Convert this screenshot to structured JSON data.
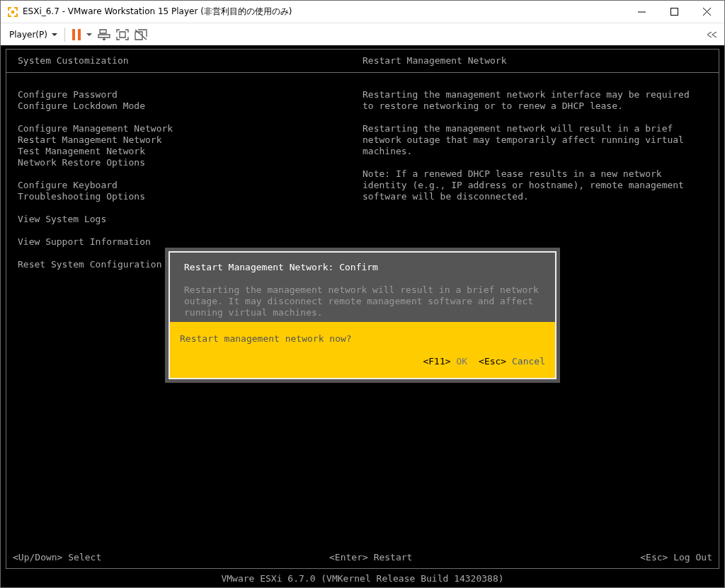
{
  "window": {
    "title": "ESXi_6.7 - VMware Workstation 15 Player (非営利目的の使用のみ)"
  },
  "toolbar": {
    "menu_label": "Player(P)"
  },
  "console": {
    "left_header": "System Customization",
    "right_header": "Restart Management Network",
    "menu_groups": [
      [
        "Configure Password",
        "Configure Lockdown Mode"
      ],
      [
        "Configure Management Network",
        "Restart Management Network",
        "Test Management Network",
        "Network Restore Options"
      ],
      [
        "Configure Keyboard",
        "Troubleshooting Options"
      ],
      [
        "View System Logs"
      ],
      [
        "View Support Information"
      ],
      [
        "Reset System Configuration"
      ]
    ],
    "description": [
      "Restarting the management network interface may be required to restore networking or to renew a DHCP lease.",
      "Restarting the management network will result in a brief network outage that may temporarily affect running virtual machines.",
      "Note: If a renewed DHCP lease results in a new network identity (e.g., IP address or hostname), remote management software will be disconnected."
    ],
    "footer_hints": [
      "<Up/Down> Select",
      "<Enter> Restart",
      "<Esc> Log Out"
    ],
    "build_line": "VMware ESXi 6.7.0 (VMKernel Release Build 14320388)"
  },
  "dialog": {
    "title": "Restart Management Network: Confirm",
    "message": "Restarting the management network will result in a brief network outage. It may disconnect remote management software and affect running virtual machines.",
    "question": "Restart management network now?",
    "actions": [
      {
        "key": "<F11>",
        "label": "OK"
      },
      {
        "key": "<Esc>",
        "label": "Cancel"
      }
    ]
  }
}
